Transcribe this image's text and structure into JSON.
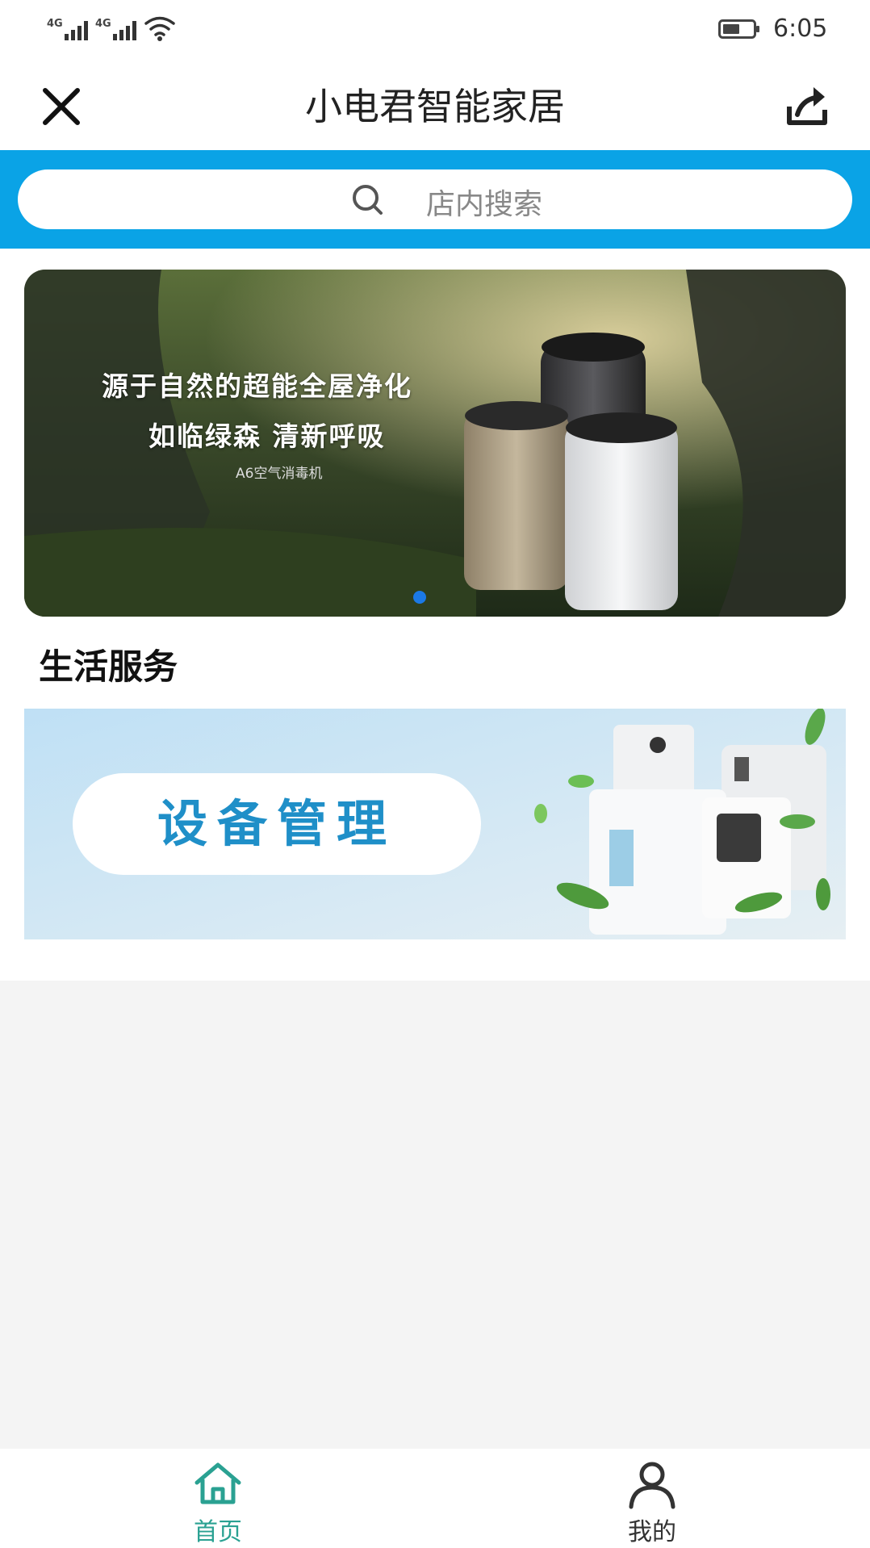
{
  "status_bar": {
    "sim1": "4G",
    "sim2": "4G",
    "time": "6:05"
  },
  "header": {
    "title": "小电君智能家居"
  },
  "search": {
    "placeholder": "店内搜索"
  },
  "banner": {
    "line1": "源于自然的超能全屋净化",
    "line2": "如临绿森 清新呼吸",
    "product": "A6空气消毒机"
  },
  "section": {
    "title": "生活服务"
  },
  "service_card": {
    "label": "设备管理"
  },
  "bottom_nav": {
    "home_label": "首页",
    "mine_label": "我的",
    "active_color": "#2aa192",
    "inactive_color": "#333333"
  },
  "colors": {
    "accent": "#0aa3e6",
    "dot": "#1b79e6"
  }
}
